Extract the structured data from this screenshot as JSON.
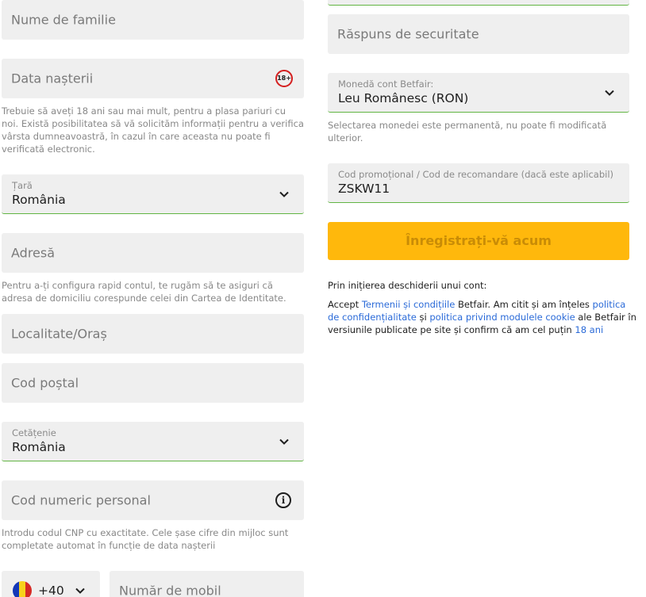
{
  "left": {
    "last_name": {
      "placeholder": "Nume de familie"
    },
    "birth_date": {
      "placeholder": "Data nașterii",
      "badge": "18+"
    },
    "age_help": "Trebuie să aveți 18 ani sau mai mult, pentru a plasa pariuri cu noi. Există posibilitatea să vă solicităm informații pentru a verifica vârsta dumneavoastră, în cazul în care aceasta nu poate fi verificată electronic.",
    "country": {
      "label": "Țară",
      "value": "România"
    },
    "address": {
      "placeholder": "Adresă"
    },
    "address_help": "Pentru a-ți configura rapid contul, te rugăm să te asiguri că adresa de domiciliu corespunde celei din Cartea de Identitate.",
    "city": {
      "placeholder": "Localitate/Oraș"
    },
    "postal_code": {
      "placeholder": "Cod poștal"
    },
    "citizenship": {
      "label": "Cetățenie",
      "value": "România"
    },
    "cnp": {
      "placeholder": "Cod numeric personal",
      "info_icon": "i"
    },
    "cnp_help": "Introdu codul CNP cu exactitate. Cele șase cifre din mijloc sunt completate automat în funcție de data nașterii",
    "phone": {
      "prefix": "+40",
      "placeholder": "Număr de mobil"
    }
  },
  "right": {
    "security_answer": {
      "placeholder": "Răspuns de securitate"
    },
    "currency": {
      "label": "Monedă cont Betfair:",
      "value": "Leu Românesc (RON)"
    },
    "currency_help": "Selectarea monedei este permanentă, nu poate fi modificată ulterior.",
    "promo": {
      "label": "Cod promoțional / Cod de recomandare (dacă este aplicabil)",
      "value": "ZSKW11"
    },
    "submit_label": "Înregistrați-vă acum",
    "terms_intro": "Prin inițierea deschiderii unui cont:",
    "terms": {
      "t1": "Accept ",
      "link1": "Termenii și condițiile",
      "t2": " Betfair. Am citit și am înțeles ",
      "link2": "politica de confidențialitate",
      "t3": " și ",
      "link3": "politica privind modulele cookie",
      "t4": " ale Betfair în versiunile publicate pe site și confirm că am cel puțin ",
      "link4": "18 ani"
    }
  },
  "colors": {
    "field_bg": "#efefef",
    "valid_border": "#62b543",
    "button": "#ffb80c",
    "link": "#2a6ad8",
    "badge_ring": "#d41f1f"
  }
}
